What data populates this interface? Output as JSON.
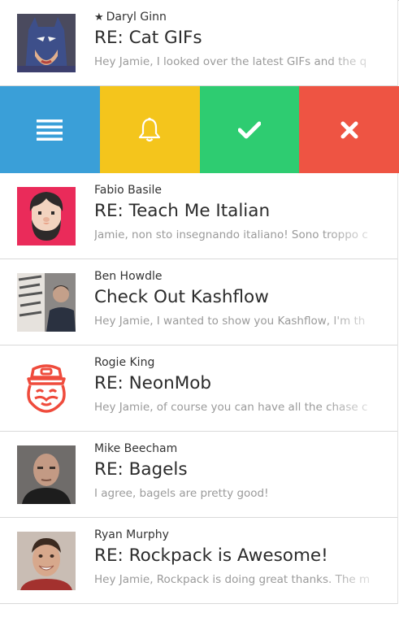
{
  "emails": [
    {
      "starred": true,
      "star_glyph": "★",
      "sender": "Daryl Ginn",
      "subject": "RE: Cat GIFs",
      "preview": "Hey Jamie, I looked over the latest GIFs and the q",
      "avatar_icon": "batman-avatar"
    },
    {
      "starred": false,
      "sender": "Fabio Basile",
      "subject": "RE: Teach Me Italian",
      "preview": "Jamie, non sto insegnando italiano! Sono troppo c",
      "avatar_icon": "bearded-man-illustration-avatar"
    },
    {
      "starred": false,
      "sender": "Ben Howdle",
      "subject": "Check Out Kashflow",
      "preview": "Hey Jamie, I wanted to show you Kashflow, I'm th",
      "avatar_icon": "man-with-poster-avatar"
    },
    {
      "starred": false,
      "sender": "Rogie King",
      "subject": "RE: NeonMob",
      "preview": "Hey Jamie, of course you can have all the chase c",
      "avatar_icon": "captain-face-logo-avatar"
    },
    {
      "starred": false,
      "sender": "Mike Beecham",
      "subject": "RE: Bagels",
      "preview": "I agree, bagels are pretty good!",
      "avatar_icon": "bald-man-avatar"
    },
    {
      "starred": false,
      "sender": "Ryan Murphy",
      "subject": "RE: Rockpack is Awesome!",
      "preview": "Hey Jamie, Rockpack is doing great thanks. The m",
      "avatar_icon": "smiling-man-avatar"
    }
  ],
  "actions": [
    {
      "icon": "list-icon",
      "color": "#3a9fd8"
    },
    {
      "icon": "bell-icon",
      "color": "#f4c51c"
    },
    {
      "icon": "checkmark-icon",
      "color": "#2ecc71"
    },
    {
      "icon": "close-icon",
      "color": "#ee5443"
    }
  ]
}
